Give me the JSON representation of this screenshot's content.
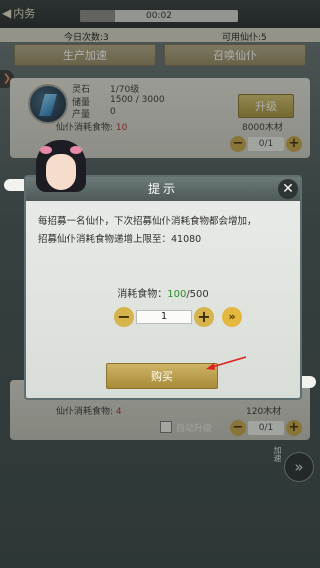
{
  "topbar": {
    "back_label": "内务",
    "timer": "00:02",
    "timer_progress": 0.22
  },
  "stats": {
    "daily_count": "今日次数:3",
    "available": "可用仙仆:5"
  },
  "actions": {
    "produce_label": "生产加速",
    "summon_label": "召唤仙仆"
  },
  "resource_card": {
    "name": "灵石",
    "level": "1/70级",
    "storage_label": "储量",
    "storage_value": "1500 / 3000",
    "production_label": "产量",
    "production_value": "0",
    "consumption_label": "仙仆消耗食物:",
    "consumption_value": "10",
    "upgrade_label": "升级",
    "cost": "8000木材",
    "servants": "0/1"
  },
  "bottom_card": {
    "consumption_label": "仙仆消耗食物:",
    "consumption_value": "4",
    "cost": "120木材",
    "servants": "0/1",
    "auto_upgrade": "自动升级",
    "side_text": "加速"
  },
  "modal": {
    "title": "提示",
    "close": "✕",
    "line1": "每招募一名仙仆，下次招募仙仆消耗食物都会增加，",
    "line2": "招募仙仆消耗食物递增上限至：41080",
    "food_label": "消耗食物：",
    "food_current": "100",
    "food_total": "/500",
    "quantity": "1",
    "max_label": "»",
    "buy_label": "购买"
  },
  "colors": {
    "gold_button": "#d7b34c",
    "consumption_red": "#b23030",
    "food_green": "#2f8a2f"
  }
}
